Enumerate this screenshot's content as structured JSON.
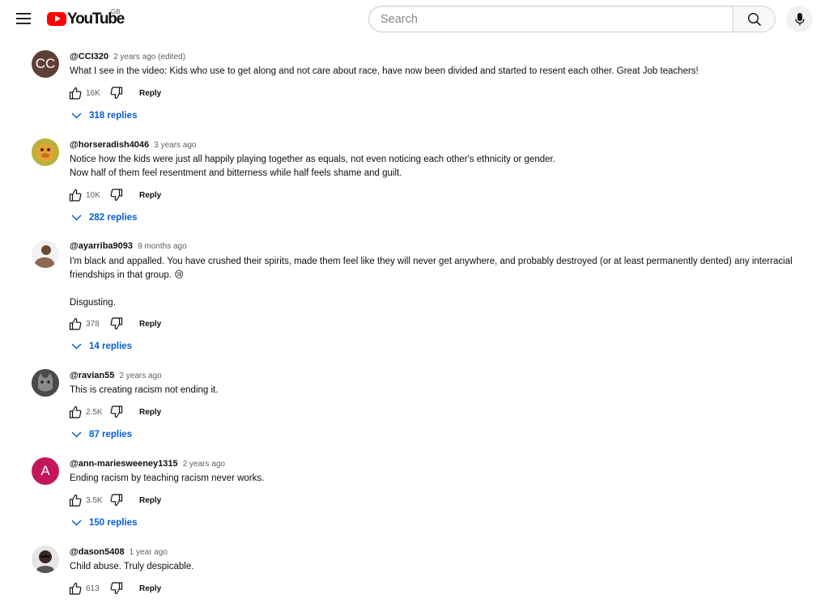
{
  "header": {
    "logo_text": "YouTube",
    "country": "GB",
    "search_placeholder": "Search"
  },
  "colors": {
    "brand_red": "#ff0000",
    "link_blue": "#065fd4"
  },
  "comments": [
    {
      "author": "@CCI320",
      "time": "2 years ago (edited)",
      "text": "What I see in the video: Kids who use to get along and not care about race, have now been divided and started to resent each other. Great Job teachers!",
      "likes": "16K",
      "reply_label": "Reply",
      "replies_label": "318 replies",
      "avatar_initials": "CC",
      "avatar_color": "#5d4037"
    },
    {
      "author": "@horseradish4046",
      "time": "3 years ago",
      "text": "Notice how the kids were just all happily playing together as equals, not even noticing each other's ethnicity or gender.\nNow half of them feel resentment and bitterness while half feels shame and guilt.",
      "likes": "10K",
      "reply_label": "Reply",
      "replies_label": "282 replies",
      "avatar_initials": "",
      "avatar_color": "#c9b23a"
    },
    {
      "author": "@ayarriba9093",
      "time": "9 months ago",
      "text": "I'm black and appalled. You have crushed their spirits, made them feel like they will never get anywhere, and probably destroyed (or at least permanently dented) any interracial friendships in that group. 😢\n\nDisgusting.",
      "likes": "378",
      "reply_label": "Reply",
      "replies_label": "14 replies",
      "avatar_initials": "",
      "avatar_color": "#e8e8e8"
    },
    {
      "author": "@ravian55",
      "time": "2 years ago",
      "text": "This is creating racism not ending it.",
      "likes": "2.5K",
      "reply_label": "Reply",
      "replies_label": "87 replies",
      "avatar_initials": "",
      "avatar_color": "#555555"
    },
    {
      "author": "@ann-mariesweeney1315",
      "time": "2 years ago",
      "text": "Ending racism by teaching racism never works.",
      "likes": "3.5K",
      "reply_label": "Reply",
      "replies_label": "150 replies",
      "avatar_initials": "A",
      "avatar_color": "#c2185b"
    },
    {
      "author": "@dason5408",
      "time": "1 year ago",
      "text": "Child abuse. Truly despicable.",
      "likes": "613",
      "reply_label": "Reply",
      "replies_label": "",
      "avatar_initials": "",
      "avatar_color": "#dddddd"
    }
  ]
}
